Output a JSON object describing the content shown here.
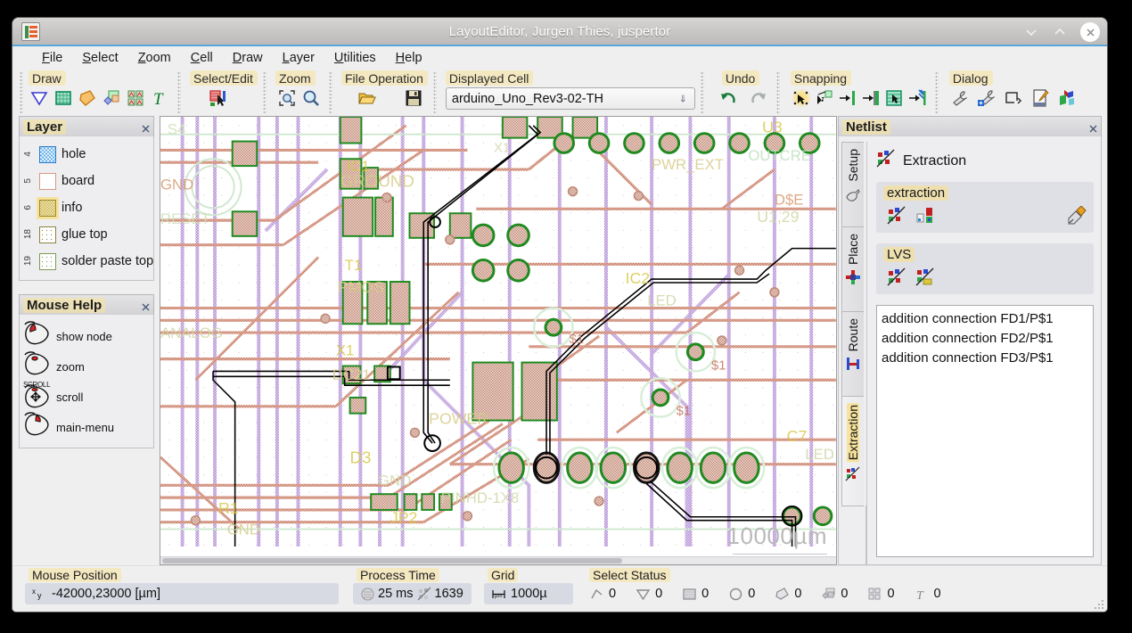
{
  "window": {
    "title": "LayoutEditor, Jurgen Thies, juspertor",
    "app_icon": "layouteditor-logo-icon",
    "minimize_label": "chevron-down-icon",
    "maximize_label": "chevron-up-icon",
    "close_label": "close-icon"
  },
  "menubar": {
    "items": [
      {
        "label": "File",
        "mnemonic": "F"
      },
      {
        "label": "Select",
        "mnemonic": "S"
      },
      {
        "label": "Zoom",
        "mnemonic": "Z"
      },
      {
        "label": "Cell",
        "mnemonic": "C"
      },
      {
        "label": "Draw",
        "mnemonic": "D"
      },
      {
        "label": "Layer",
        "mnemonic": "L"
      },
      {
        "label": "Utilities",
        "mnemonic": "U"
      },
      {
        "label": "Help",
        "mnemonic": "H"
      }
    ]
  },
  "toolbars": {
    "draw": {
      "label": "Draw",
      "icons": [
        "polygon-icon",
        "box-icon",
        "path-icon",
        "cell-reference-icon",
        "array-reference-icon",
        "text-icon"
      ]
    },
    "select_edit": {
      "label": "Select/Edit",
      "icons": [
        "select-edit-icon"
      ]
    },
    "zoom": {
      "label": "Zoom",
      "icons": [
        "zoom-fit-icon",
        "zoom-magnifier-icon"
      ]
    },
    "file_operation": {
      "label": "File Operation",
      "icons": [
        "open-folder-icon",
        "save-floppy-icon"
      ]
    },
    "displayed_cell": {
      "label": "Displayed Cell",
      "value": "arduino_Uno_Rev3-02-TH",
      "dropdown_icon": "chevron-down-icon"
    },
    "undo": {
      "label": "Undo",
      "icons": [
        "undo-arrow-icon",
        "redo-arrow-icon"
      ]
    },
    "snapping": {
      "label": "Snapping",
      "icons": [
        "snap-any-icon",
        "snap-edge-icon",
        "snap-point-icon",
        "snap-grid-icon",
        "snap-area-icon",
        "snap-line-icon"
      ]
    },
    "dialog": {
      "label": "Dialog",
      "icons": [
        "wrench-icon",
        "wrench-blue-icon",
        "ruler-icon",
        "notepad-edit-icon",
        "3d-view-icon"
      ]
    }
  },
  "left_dock": {
    "layer_panel": {
      "title": "Layer",
      "float_icon": "undock-icon",
      "close_icon": "close-icon",
      "layers": [
        {
          "number": "4",
          "name": "hole",
          "color": "#55a8e8",
          "selected": false
        },
        {
          "number": "5",
          "name": "board",
          "color": "#d49b84",
          "selected": false
        },
        {
          "number": "6",
          "name": "info",
          "color": "#c8b04a",
          "selected": true
        },
        {
          "number": "18",
          "name": "glue top",
          "color": "#8d8342",
          "selected": false
        },
        {
          "number": "19",
          "name": "solder paste top",
          "color": "#7f9a55",
          "selected": false
        }
      ]
    },
    "mouse_help_panel": {
      "title": "Mouse Help",
      "float_icon": "undock-icon",
      "close_icon": "close-icon",
      "rows": [
        {
          "label": "show node",
          "button": "left",
          "tag": "",
          "icon": "mouse-left-click-icon"
        },
        {
          "label": "zoom",
          "button": "middle",
          "tag": "",
          "icon": "mouse-middle-click-icon"
        },
        {
          "label": "scroll",
          "button": "scroll",
          "tag": "SCROLL",
          "icon": "mouse-scroll-icon"
        },
        {
          "label": "main-menu",
          "button": "right",
          "tag": "",
          "icon": "mouse-right-click-icon"
        }
      ]
    }
  },
  "canvas": {
    "scale_bar": "10000µm",
    "labels": [
      "S4",
      "GND",
      "RESET",
      "GROUND",
      "IC1",
      "RN5",
      "T1",
      "PMOS",
      "D3",
      "JP2",
      "POWER",
      "PINHD-1X8",
      "C7",
      "LED",
      "U3",
      "$1",
      "$1",
      "$1"
    ]
  },
  "right_dock": {
    "title": "Netlist",
    "float_icon": "undock-icon",
    "close_icon": "close-icon",
    "vtabs": [
      {
        "label": "Setup",
        "icon": "setup-icon",
        "selected": false
      },
      {
        "label": "Place",
        "icon": "place-icon",
        "selected": false
      },
      {
        "label": "Route",
        "icon": "route-icon",
        "selected": false
      },
      {
        "label": "Extraction",
        "icon": "extraction-icon",
        "selected": true
      }
    ],
    "header": {
      "icon": "extraction-icon",
      "text": "Extraction"
    },
    "groups": [
      {
        "label": "extraction",
        "icons": [
          "extract-netlist-icon",
          "netlist-view-icon"
        ],
        "right_icon": "edit-netlist-icon"
      },
      {
        "label": "LVS",
        "icons": [
          "lvs-compare-icon",
          "lvs-report-icon"
        ],
        "right_icon": null
      }
    ],
    "messages": [
      "addition connection FD1/P$1",
      "addition connection FD2/P$1",
      "addition connection FD3/P$1"
    ]
  },
  "statusbar": {
    "mouse_position": {
      "label": "Mouse Position",
      "icon": "xy-coordinate-icon",
      "value": "-42000,23000 [µm]"
    },
    "process_time": {
      "label": "Process Time",
      "time_icon": "hourglass-icon",
      "time_value": "25 ms",
      "count_icon": "element-count-icon",
      "count_value": "1639"
    },
    "grid": {
      "label": "Grid",
      "icon": "grid-measure-icon",
      "value": "1000µ"
    },
    "select_status": {
      "label": "Select Status",
      "counters": [
        {
          "icon": "path-select-icon",
          "value": "0"
        },
        {
          "icon": "polygon-select-icon",
          "value": "0"
        },
        {
          "icon": "box-select-icon",
          "value": "0"
        },
        {
          "icon": "circle-select-icon",
          "value": "0"
        },
        {
          "icon": "path2-select-icon",
          "value": "0"
        },
        {
          "icon": "cellref-select-icon",
          "value": "0"
        },
        {
          "icon": "array-select-icon",
          "value": "0"
        },
        {
          "icon": "text-select-icon",
          "value": "0"
        }
      ]
    }
  },
  "colors": {
    "accent": "#5aa7dd",
    "highlight": "#fade82",
    "panel_bg": "#eeeef0",
    "group_bg": "#dfe0e6",
    "copper": "#c98a72",
    "route_violet": "#b99ad6",
    "pad_green": "#1f8a1f",
    "silk_yellow": "#d9c84a"
  }
}
